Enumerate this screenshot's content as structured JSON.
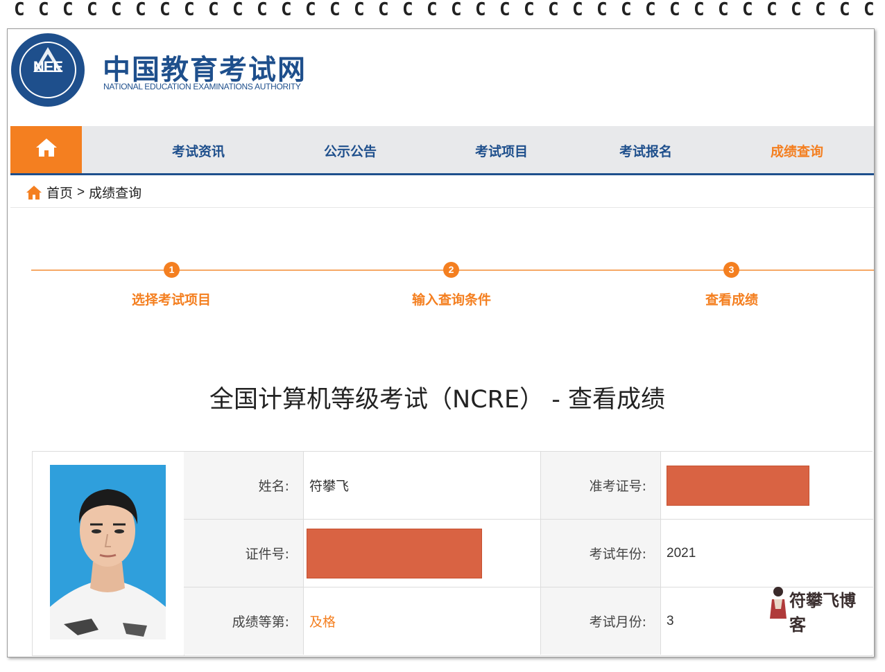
{
  "header": {
    "logo_text": "NEE",
    "brand_cn": "中国教育考试网",
    "brand_en": "NATIONAL EDUCATION EXAMINATIONS AUTHORITY"
  },
  "nav": {
    "home_icon": "home-icon",
    "items": [
      {
        "label": "考试资讯",
        "active": false
      },
      {
        "label": "公示公告",
        "active": false
      },
      {
        "label": "考试项目",
        "active": false
      },
      {
        "label": "考试报名",
        "active": false
      },
      {
        "label": "成绩查询",
        "active": true
      }
    ]
  },
  "breadcrumb": {
    "home_label": "首页",
    "separator": ">",
    "current": "成绩查询"
  },
  "steps": [
    {
      "number": "1",
      "label": "选择考试项目"
    },
    {
      "number": "2",
      "label": "输入查询条件"
    },
    {
      "number": "3",
      "label": "查看成绩"
    }
  ],
  "page_title": "全国计算机等级考试（NCRE） - 查看成绩",
  "result": {
    "name_label": "姓名:",
    "name_value": "符攀飞",
    "admission_label": "准考证号:",
    "id_label": "证件号:",
    "year_label": "考试年份:",
    "year_value": "2021",
    "grade_label": "成绩等第:",
    "grade_value": "及格",
    "month_label": "考试月份:",
    "month_value": "3"
  },
  "watermark": {
    "text": "符攀飞博客"
  },
  "colors": {
    "brand_blue": "#1e4f8c",
    "accent_orange": "#f47f20",
    "redact": "#d96343"
  }
}
